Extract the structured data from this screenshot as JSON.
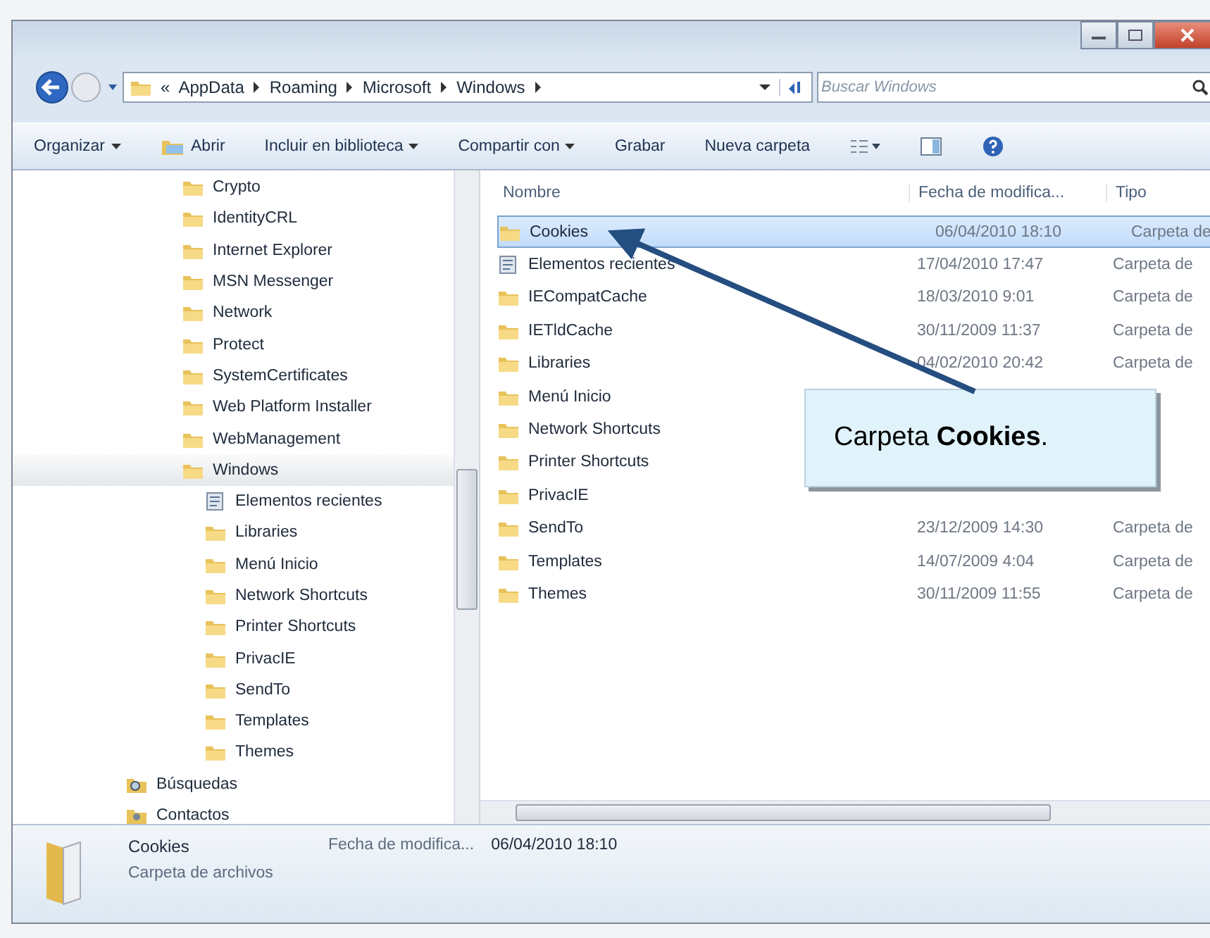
{
  "address_bar": {
    "overflow": "«",
    "crumbs": [
      "AppData",
      "Roaming",
      "Microsoft",
      "Windows"
    ]
  },
  "search": {
    "placeholder": "Buscar Windows"
  },
  "toolbar": [
    {
      "label": "Organizar",
      "kind": "menu"
    },
    {
      "label": "Abrir",
      "kind": "open"
    },
    {
      "label": "Incluir en biblioteca",
      "kind": "menu"
    },
    {
      "label": "Compartir con",
      "kind": "menu"
    },
    {
      "label": "Grabar",
      "kind": "plain"
    },
    {
      "label": "Nueva carpeta",
      "kind": "plain"
    }
  ],
  "nav_tree": [
    {
      "children": [
        {
          "label": "Crypto",
          "kind": "folder",
          "selected": false
        },
        {
          "label": "IdentityCRL",
          "kind": "folder",
          "selected": false
        },
        {
          "label": "Internet Explorer",
          "kind": "folder",
          "selected": false
        },
        {
          "label": "MSN Messenger",
          "kind": "folder",
          "selected": false
        },
        {
          "label": "Network",
          "kind": "folder",
          "selected": false
        },
        {
          "label": "Protect",
          "kind": "folder",
          "selected": false
        },
        {
          "label": "SystemCertificates",
          "kind": "folder",
          "selected": false
        },
        {
          "label": "Web Platform Installer",
          "kind": "folder",
          "selected": false
        },
        {
          "label": "WebManagement",
          "kind": "folder",
          "selected": false
        },
        {
          "label": "Windows",
          "kind": "folder",
          "selected": true,
          "children": [
            {
              "label": "Elementos recientes",
              "kind": "recent",
              "selected": false
            },
            {
              "label": "Libraries",
              "kind": "folder",
              "selected": false
            },
            {
              "label": "Menú Inicio",
              "kind": "folder",
              "selected": false
            },
            {
              "label": "Network Shortcuts",
              "kind": "folder",
              "selected": false
            },
            {
              "label": "Printer Shortcuts",
              "kind": "folder",
              "selected": false
            },
            {
              "label": "PrivacIE",
              "kind": "folder",
              "selected": false
            },
            {
              "label": "SendTo",
              "kind": "folder",
              "selected": false
            },
            {
              "label": "Templates",
              "kind": "folder",
              "selected": false
            },
            {
              "label": "Themes",
              "kind": "folder",
              "selected": false
            }
          ]
        }
      ]
    },
    {
      "label": "Búsquedas",
      "kind": "search",
      "selected": false
    },
    {
      "label": "Contactos",
      "kind": "contacts",
      "selected": false
    }
  ],
  "table": {
    "columns": [
      "Nombre",
      "Fecha de modifica...",
      "Tipo"
    ],
    "rows": [
      {
        "name": "Cookies",
        "kind": "folder",
        "date": "06/04/2010 18:10",
        "type": "Carpeta de",
        "selected": true
      },
      {
        "name": "Elementos recientes",
        "kind": "recent",
        "date": "17/04/2010 17:47",
        "type": "Carpeta de",
        "selected": false
      },
      {
        "name": "IECompatCache",
        "kind": "folder",
        "date": "18/03/2010 9:01",
        "type": "Carpeta de",
        "selected": false
      },
      {
        "name": "IETldCache",
        "kind": "folder",
        "date": "30/11/2009 11:37",
        "type": "Carpeta de",
        "selected": false
      },
      {
        "name": "Libraries",
        "kind": "folder",
        "date": "04/02/2010 20:42",
        "type": "Carpeta de",
        "selected": false
      },
      {
        "name": "Menú Inicio",
        "kind": "folder",
        "selected": false
      },
      {
        "name": "Network Shortcuts",
        "kind": "folder",
        "selected": false
      },
      {
        "name": "Printer Shortcuts",
        "kind": "folder",
        "selected": false
      },
      {
        "name": "PrivacIE",
        "kind": "folder",
        "selected": false
      },
      {
        "name": "SendTo",
        "kind": "folder",
        "date": "23/12/2009 14:30",
        "type": "Carpeta de",
        "selected": false
      },
      {
        "name": "Templates",
        "kind": "folder",
        "date": "14/07/2009 4:04",
        "type": "Carpeta de",
        "selected": false
      },
      {
        "name": "Themes",
        "kind": "folder",
        "date": "30/11/2009 11:55",
        "type": "Carpeta de",
        "selected": false
      }
    ]
  },
  "details": {
    "name": "Cookies",
    "type": "Carpeta de archivos",
    "date_label": "Fecha de modifica...",
    "date": "06/04/2010 18:10"
  },
  "callout": {
    "text": "Carpeta **Cookies**."
  }
}
